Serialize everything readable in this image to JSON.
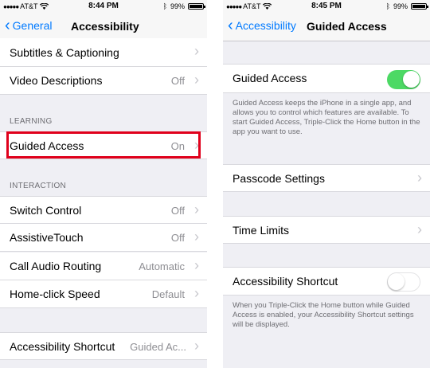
{
  "colors": {
    "accent": "#007aff",
    "switch_on": "#4cd964",
    "highlight": "#e0001b"
  },
  "left": {
    "status": {
      "carrier": "AT&T",
      "time": "8:44 PM",
      "battery": "99%",
      "battery_level": 0.99
    },
    "nav": {
      "back_label": "General",
      "title": "Accessibility"
    },
    "rows": {
      "subtitles": {
        "label": "Subtitles & Captioning"
      },
      "video_descriptions": {
        "label": "Video Descriptions",
        "value": "Off"
      },
      "guided_access": {
        "label": "Guided Access",
        "value": "On"
      },
      "switch_control": {
        "label": "Switch Control",
        "value": "Off"
      },
      "assistive_touch": {
        "label": "AssistiveTouch",
        "value": "Off"
      },
      "call_audio_routing": {
        "label": "Call Audio Routing",
        "value": "Automatic"
      },
      "home_click_speed": {
        "label": "Home-click Speed",
        "value": "Default"
      },
      "accessibility_shortcut": {
        "label": "Accessibility Shortcut",
        "value": "Guided Ac..."
      }
    },
    "sections": {
      "learning": "LEARNING",
      "interaction": "INTERACTION"
    }
  },
  "right": {
    "status": {
      "carrier": "AT&T",
      "time": "8:45 PM",
      "battery": "99%",
      "battery_level": 0.99
    },
    "nav": {
      "back_label": "Accessibility",
      "title": "Guided Access"
    },
    "guided_access": {
      "label": "Guided Access",
      "enabled": true,
      "description": "Guided Access keeps the iPhone in a single app, and allows you to control which features are available. To start Guided Access, Triple-Click the Home button in the app you want to use."
    },
    "passcode_settings": {
      "label": "Passcode Settings"
    },
    "time_limits": {
      "label": "Time Limits"
    },
    "accessibility_shortcut": {
      "label": "Accessibility Shortcut",
      "enabled": false,
      "description": "When you Triple-Click the Home button while Guided Access is enabled, your Accessibility Shortcut settings will be displayed."
    }
  },
  "icons": {
    "signal": "signal-dots-icon",
    "wifi": "wifi-icon",
    "bluetooth": "bluetooth-icon",
    "battery": "battery-icon",
    "back": "chevron-left-icon",
    "disclosure": "chevron-right-icon"
  }
}
